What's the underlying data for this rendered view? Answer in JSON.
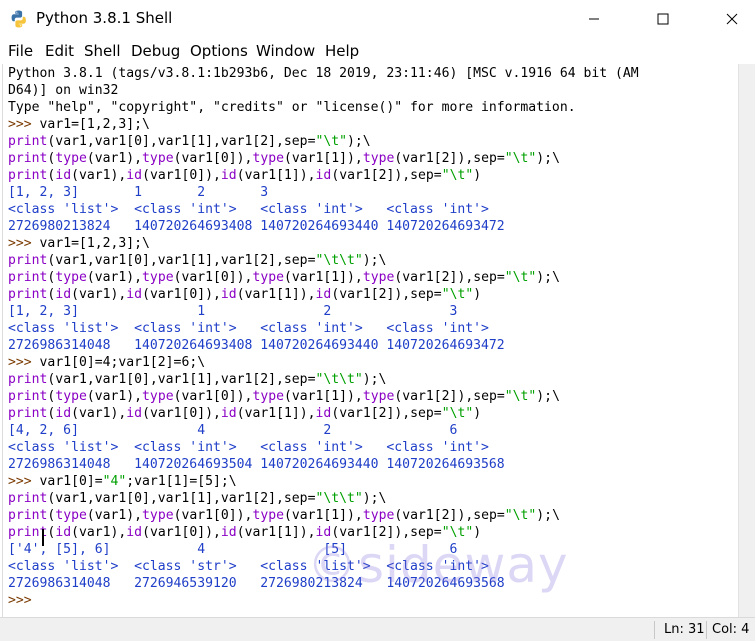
{
  "window": {
    "title": "Python 3.8.1 Shell",
    "icon": "python-icon",
    "controls": [
      "minimize-icon",
      "maximize-icon",
      "close-icon"
    ]
  },
  "menubar": {
    "items": [
      "File",
      "Edit",
      "Shell",
      "Debug",
      "Options",
      "Window",
      "Help"
    ]
  },
  "shell": {
    "banner": [
      "Python 3.8.1 (tags/v3.8.1:1b293b6, Dec 18 2019, 23:11:46) [MSC v.1916 64 bit (AM",
      "D64)] on win32",
      "Type \"help\", \"copyright\", \"credits\" or \"license()\" for more information."
    ],
    "blocks": [
      {
        "prompt": ">>> ",
        "command": "var1=[1,2,3];\\",
        "code": [
          "print(var1,var1[0],var1[1],var1[2],sep=\"\\t\");\\",
          "print(type(var1),type(var1[0]),type(var1[1]),type(var1[2]),sep=\"\\t\");\\",
          "print(id(var1),id(var1[0]),id(var1[1]),id(var1[2]),sep=\"\\t\")"
        ],
        "output": [
          "[1, 2, 3]       1       2       3",
          "<class 'list'>  <class 'int'>   <class 'int'>   <class 'int'>",
          "2726980213824   140720264693408 140720264693440 140720264693472"
        ]
      },
      {
        "prompt": ">>> ",
        "command": "var1=[1,2,3];\\",
        "code": [
          "print(var1,var1[0],var1[1],var1[2],sep=\"\\t\\t\");\\",
          "print(type(var1),type(var1[0]),type(var1[1]),type(var1[2]),sep=\"\\t\");\\",
          "print(id(var1),id(var1[0]),id(var1[1]),id(var1[2]),sep=\"\\t\")"
        ],
        "output": [
          "[1, 2, 3]               1               2               3",
          "<class 'list'>  <class 'int'>   <class 'int'>   <class 'int'>",
          "2726986314048   140720264693408 140720264693440 140720264693472"
        ]
      },
      {
        "prompt": ">>> ",
        "command": "var1[0]=4;var1[2]=6;\\",
        "code": [
          "print(var1,var1[0],var1[1],var1[2],sep=\"\\t\\t\");\\",
          "print(type(var1),type(var1[0]),type(var1[1]),type(var1[2]),sep=\"\\t\");\\",
          "print(id(var1),id(var1[0]),id(var1[1]),id(var1[2]),sep=\"\\t\")"
        ],
        "output": [
          "[4, 2, 6]               4               2               6",
          "<class 'list'>  <class 'int'>   <class 'int'>   <class 'int'>",
          "2726986314048   140720264693504 140720264693440 140720264693568"
        ]
      },
      {
        "prompt": ">>> ",
        "command": "var1[0]=\"4\";var1[1]=[5];\\",
        "code": [
          "print(var1,var1[0],var1[1],var1[2],sep=\"\\t\\t\");\\",
          "print(type(var1),type(var1[0]),type(var1[1]),type(var1[2]),sep=\"\\t\");\\",
          "print(id(var1),id(var1[0]),id(var1[1]),id(var1[2]),sep=\"\\t\")"
        ],
        "output": [
          "['4', [5], 6]           4               [5]             6",
          "<class 'list'>  <class 'str'>   <class 'list'>  <class 'int'>",
          "2726986314048   2726946539120   2726980213824   140720264693568"
        ]
      }
    ],
    "final_prompt": ">>> ",
    "watermark": "©sideway"
  },
  "statusbar": {
    "line": "Ln: 31",
    "col": "Col: 4"
  },
  "colors": {
    "prompt": "#7a3a00",
    "builtin": "#8a00c4",
    "string": "#00a000",
    "output": "#1f3ec8",
    "text": "#000000"
  }
}
